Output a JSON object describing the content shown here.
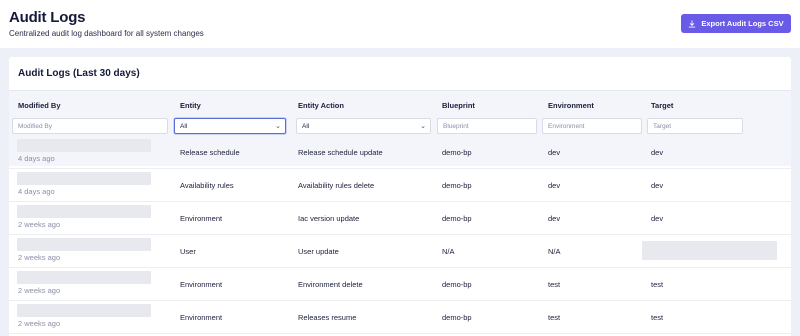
{
  "page": {
    "title": "Audit Logs",
    "subtitle": "Centralized audit log dashboard for all system changes",
    "export_label": "Export Audit Logs CSV"
  },
  "card": {
    "title": "Audit Logs (Last 30 days)"
  },
  "columns": {
    "modified_by": "Modified By",
    "entity": "Entity",
    "entity_action": "Entity Action",
    "blueprint": "Blueprint",
    "environment": "Environment",
    "target": "Target"
  },
  "filters": {
    "modified_by_placeholder": "Modified By",
    "entity_value": "All",
    "entity_action_value": "All",
    "blueprint_placeholder": "Blueprint",
    "environment_placeholder": "Environment",
    "target_placeholder": "Target"
  },
  "rows": [
    {
      "time": "4 days ago",
      "entity": "Release schedule",
      "action": "Release schedule update",
      "blueprint": "demo-bp",
      "environment": "dev",
      "target": "dev"
    },
    {
      "time": "4 days ago",
      "entity": "Availability rules",
      "action": "Availability rules delete",
      "blueprint": "demo-bp",
      "environment": "dev",
      "target": "dev"
    },
    {
      "time": "2 weeks ago",
      "entity": "Environment",
      "action": "Iac version update",
      "blueprint": "demo-bp",
      "environment": "dev",
      "target": "dev"
    },
    {
      "time": "2 weeks ago",
      "entity": "User",
      "action": "User update",
      "blueprint": "N/A",
      "environment": "N/A",
      "target": ""
    },
    {
      "time": "2 weeks ago",
      "entity": "Environment",
      "action": "Environment delete",
      "blueprint": "demo-bp",
      "environment": "test",
      "target": "test"
    },
    {
      "time": "2 weeks ago",
      "entity": "Environment",
      "action": "Releases resume",
      "blueprint": "demo-bp",
      "environment": "test",
      "target": "test"
    }
  ],
  "colors": {
    "accent": "#6a5ae8",
    "background": "#eef0f7",
    "header_bg": "#f4f5fa"
  },
  "icons": {
    "export": "download-icon"
  }
}
